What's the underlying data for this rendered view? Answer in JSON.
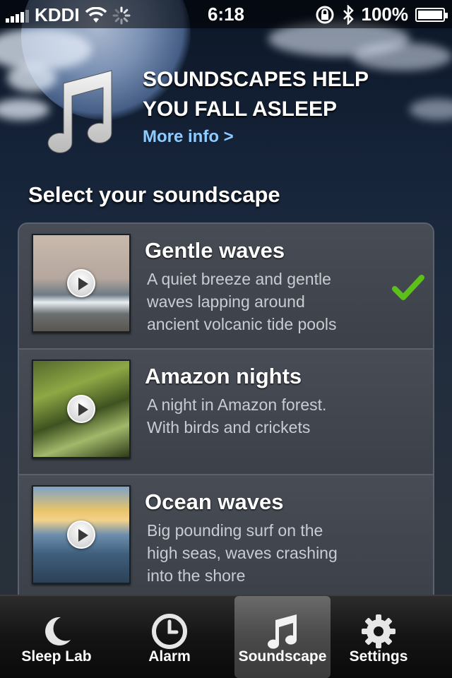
{
  "status_bar": {
    "carrier": "KDDI",
    "time": "6:18",
    "battery": "100%",
    "icons": [
      "signal-icon",
      "wifi-icon",
      "activity-spinner-icon",
      "rotation-lock-icon",
      "bluetooth-icon",
      "battery-icon"
    ]
  },
  "header": {
    "headline_line1": "SOUNDSCAPES HELP",
    "headline_line2": "YOU FALL ASLEEP",
    "more_info": "More info >",
    "icon": "music-note-icon"
  },
  "section_title": "Select your soundscape",
  "soundscapes": [
    {
      "title": "Gentle waves",
      "desc_lines": [
        "A quiet breeze and gentle",
        "waves lapping around",
        "ancient volcanic tide pools"
      ],
      "selected": true
    },
    {
      "title": "Amazon nights",
      "desc_lines": [
        "A night in Amazon forest.",
        "With birds and crickets"
      ],
      "selected": false
    },
    {
      "title": "Ocean waves",
      "desc_lines": [
        "Big pounding surf on the",
        "high seas, waves crashing",
        "into the shore"
      ],
      "selected": false
    }
  ],
  "tabs": [
    {
      "label": "Sleep Lab",
      "icon": "moon-icon",
      "active": false
    },
    {
      "label": "Alarm",
      "icon": "clock-icon",
      "active": false
    },
    {
      "label": "Soundscape",
      "icon": "music-note-icon",
      "active": true
    },
    {
      "label": "Settings",
      "icon": "gear-icon",
      "active": false
    }
  ],
  "colors": {
    "accent_link": "#8ecbff",
    "checkmark": "#5cbf1a"
  }
}
